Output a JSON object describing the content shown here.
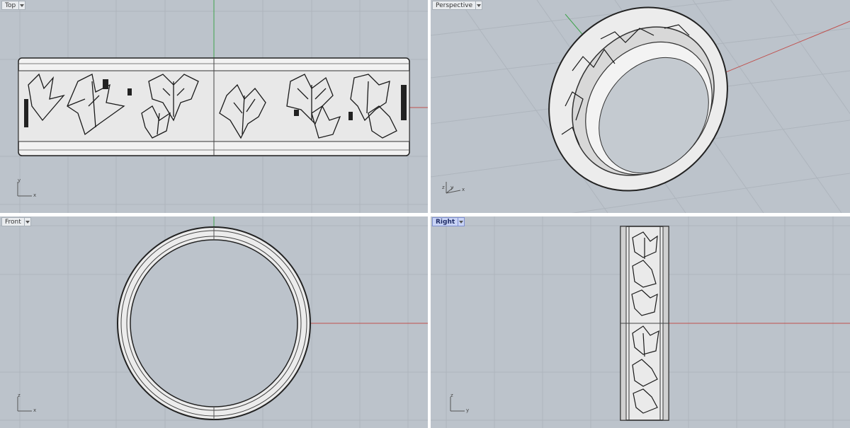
{
  "viewports": {
    "top": {
      "label": "Top",
      "axes": [
        "y",
        "x"
      ]
    },
    "perspective": {
      "label": "Perspective",
      "axes": [
        "z",
        "y",
        "x"
      ]
    },
    "front": {
      "label": "Front",
      "axes": [
        "z",
        "x"
      ]
    },
    "right": {
      "label": "Right",
      "axes": [
        "z",
        "y"
      ]
    }
  },
  "colors": {
    "viewport_bg": "#bcc3cb",
    "grid_line": "#adb4bc",
    "x_axis": "#c0504d",
    "y_axis": "#3fa34d",
    "active_tab": "#c8d3f5"
  }
}
